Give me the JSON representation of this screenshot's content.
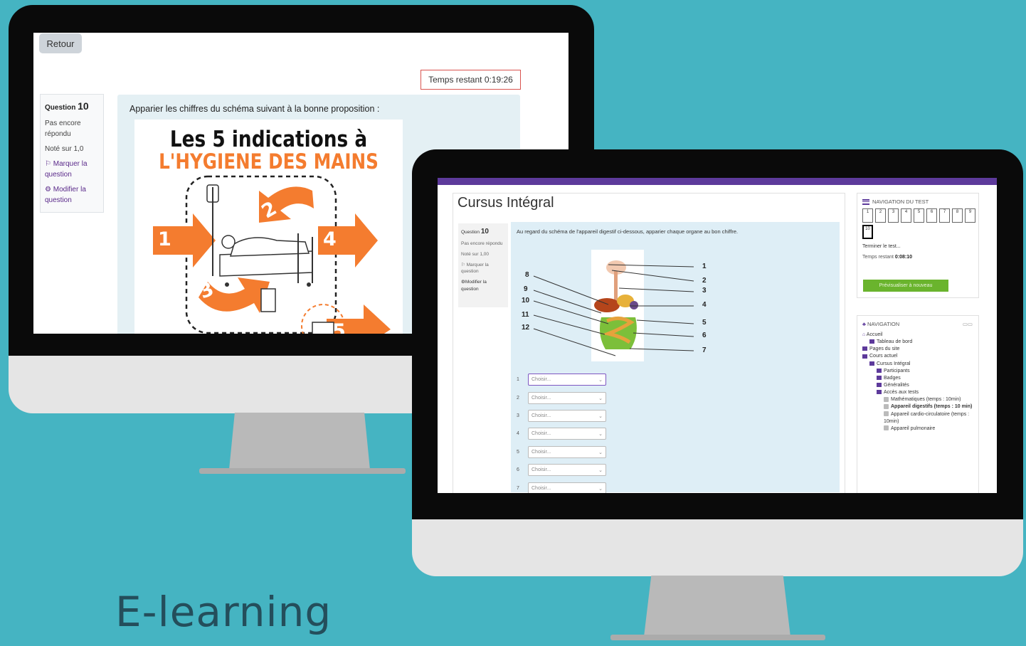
{
  "caption": "E-learning",
  "screen1": {
    "back_label": "Retour",
    "timer": "Temps restant 0:19:26",
    "question": {
      "prefix": "Question",
      "number": "10",
      "status": "Pas encore répondu",
      "score": "Noté sur 1,0",
      "flag_label": "Marquer la question",
      "edit_label": "Modifier la question"
    },
    "prompt": "Apparier les chiffres du schéma suivant à la bonne proposition :",
    "poster": {
      "title_line1": "Les 5 indications à",
      "title_line2": "L'HYGIENE DES MAINS",
      "numbers": [
        "1",
        "2",
        "3",
        "4",
        "5"
      ]
    }
  },
  "screen2": {
    "course_title": "Cursus Intégral",
    "question": {
      "prefix": "Question",
      "number": "10",
      "status": "Pas encore répondu",
      "score": "Noté sur 1,00",
      "flag_label": "Marquer la question",
      "edit_label": "Modifier la question"
    },
    "prompt": "Au regard du schéma de l'appareil digestif ci-dessous, apparier chaque organe au bon chiffre.",
    "diagram_labels_left": [
      "8",
      "9",
      "10",
      "11",
      "12"
    ],
    "diagram_labels_right": [
      "1",
      "2",
      "3",
      "4",
      "5",
      "6",
      "7"
    ],
    "answers": [
      {
        "n": "1",
        "value": "Choisir..."
      },
      {
        "n": "2",
        "value": "Choisir..."
      },
      {
        "n": "3",
        "value": "Choisir..."
      },
      {
        "n": "4",
        "value": "Choisir..."
      },
      {
        "n": "5",
        "value": "Choisir..."
      },
      {
        "n": "6",
        "value": "Choisir..."
      },
      {
        "n": "7",
        "value": "Choisir..."
      }
    ],
    "quiz_nav": {
      "title": "NAVIGATION DU TEST",
      "buttons": [
        "1",
        "2",
        "3",
        "4",
        "5",
        "6",
        "7",
        "8",
        "9",
        "10"
      ],
      "current": "10",
      "finish_link": "Terminer le test...",
      "time_label": "Temps restant",
      "time_value": "0:08:10",
      "restart_button": "Prévisualiser à nouveau"
    },
    "navigation": {
      "title": "NAVIGATION",
      "home": "Accueil",
      "dashboard": "Tableau de bord",
      "site_pages": "Pages du site",
      "current_course": "Cours actuel",
      "course": "Cursus Intégral",
      "participants": "Participants",
      "badges": "Badges",
      "general": "Généralités",
      "tests_access": "Accès aux tests",
      "test1": "Mathématiques (temps : 10min)",
      "test2": "Appareil digestifs (temps : 10 min)",
      "test3": "Appareil cardio-circulatoire (temps : 10min)",
      "test4": "Appareil pulmonaire"
    }
  },
  "colors": {
    "background": "#45b4c2",
    "accent_orange": "#f47c2f",
    "moodle_purple": "#5d3a9b",
    "timer_border": "#d9534f",
    "preview_green": "#6ab42d"
  }
}
